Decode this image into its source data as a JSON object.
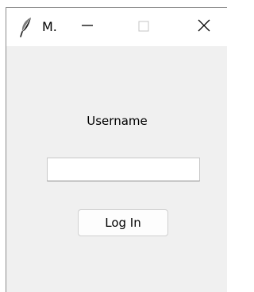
{
  "window": {
    "title": "M.",
    "app_icon": "feather-icon",
    "controls": {
      "minimize_icon": "minimize-icon",
      "maximize_icon": "maximize-icon",
      "close_icon": "close-icon"
    }
  },
  "form": {
    "username_label": "Username",
    "username_value": "",
    "login_label": "Log In"
  },
  "colors": {
    "titlebar_bg": "#ffffff",
    "content_bg": "#f0f0f0",
    "input_bg": "#ffffff",
    "button_bg": "#fdfdfd",
    "text": "#000000"
  }
}
